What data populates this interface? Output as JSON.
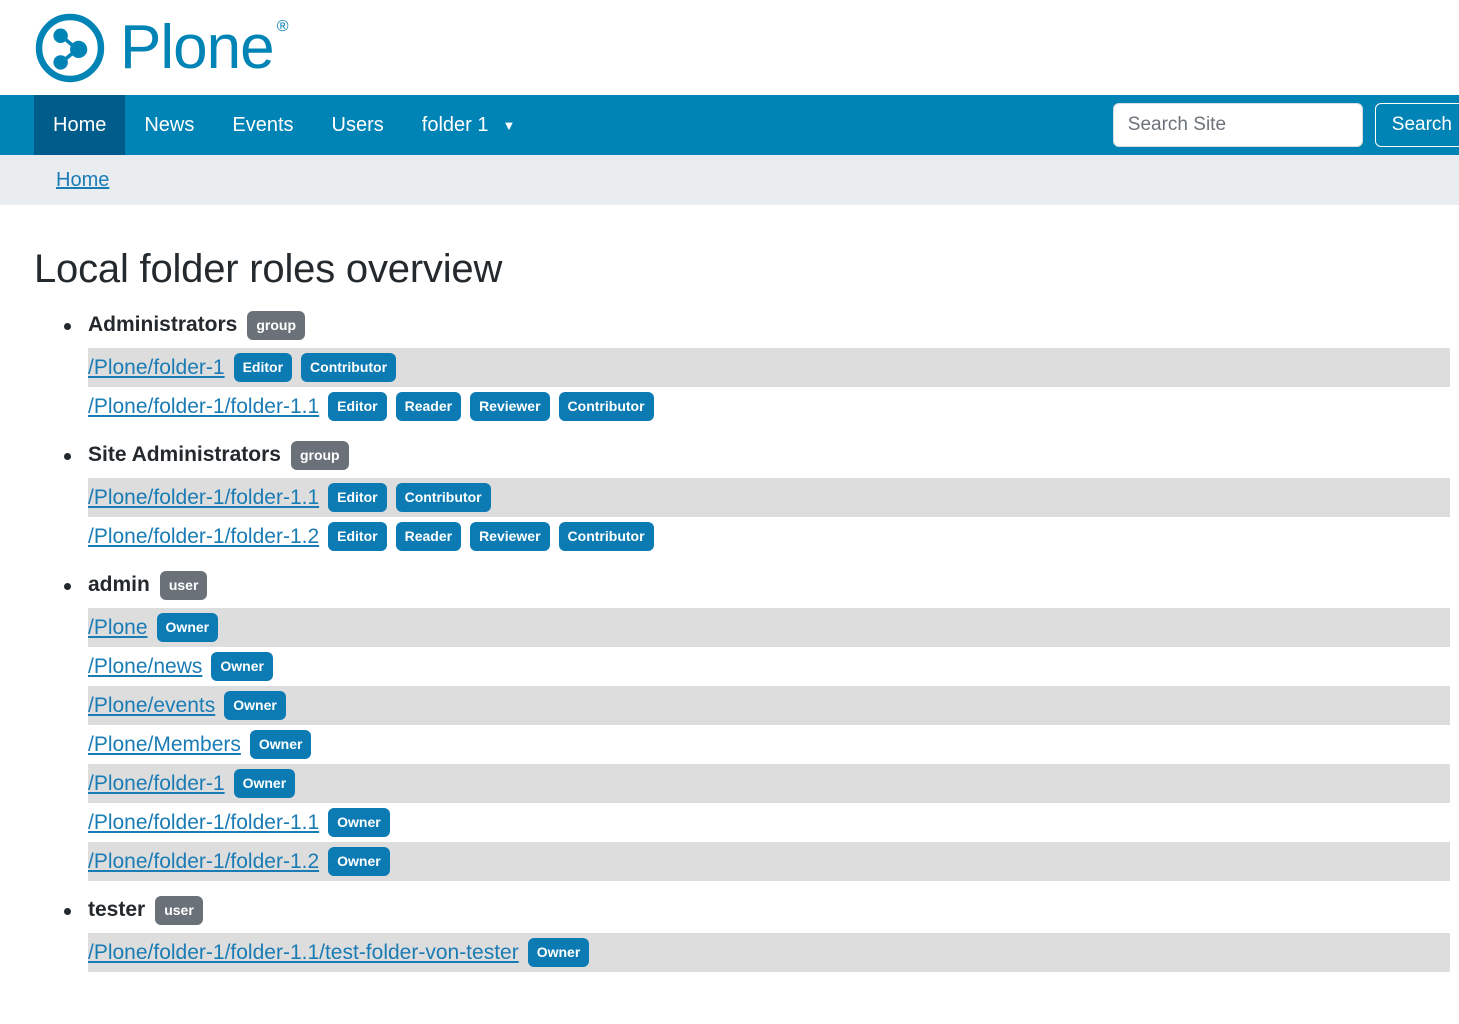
{
  "site": {
    "logo_text": "Plone",
    "logo_registered_mark": "®",
    "logo_icon": "plone-logo-icon"
  },
  "nav": {
    "items": [
      {
        "label": "Home",
        "active": true,
        "has_caret": false
      },
      {
        "label": "News",
        "active": false,
        "has_caret": false
      },
      {
        "label": "Events",
        "active": false,
        "has_caret": false
      },
      {
        "label": "Users",
        "active": false,
        "has_caret": false
      },
      {
        "label": "folder 1",
        "active": false,
        "has_caret": true
      }
    ],
    "caret_glyph": "▼"
  },
  "search": {
    "placeholder": "Search Site",
    "value": "",
    "button_label": "Search"
  },
  "breadcrumb": {
    "items": [
      {
        "label": "Home"
      }
    ]
  },
  "main": {
    "title": "Local folder roles overview",
    "principals": [
      {
        "name": "Administrators",
        "type": "group",
        "paths": [
          {
            "path": "/Plone/folder-1",
            "roles": [
              "Editor",
              "Contributor"
            ]
          },
          {
            "path": "/Plone/folder-1/folder-1.1",
            "roles": [
              "Editor",
              "Reader",
              "Reviewer",
              "Contributor"
            ]
          }
        ]
      },
      {
        "name": "Site Administrators",
        "type": "group",
        "paths": [
          {
            "path": "/Plone/folder-1/folder-1.1",
            "roles": [
              "Editor",
              "Contributor"
            ]
          },
          {
            "path": "/Plone/folder-1/folder-1.2",
            "roles": [
              "Editor",
              "Reader",
              "Reviewer",
              "Contributor"
            ]
          }
        ]
      },
      {
        "name": "admin",
        "type": "user",
        "paths": [
          {
            "path": "/Plone",
            "roles": [
              "Owner"
            ]
          },
          {
            "path": "/Plone/news",
            "roles": [
              "Owner"
            ]
          },
          {
            "path": "/Plone/events",
            "roles": [
              "Owner"
            ]
          },
          {
            "path": "/Plone/Members",
            "roles": [
              "Owner"
            ]
          },
          {
            "path": "/Plone/folder-1",
            "roles": [
              "Owner"
            ]
          },
          {
            "path": "/Plone/folder-1/folder-1.1",
            "roles": [
              "Owner"
            ]
          },
          {
            "path": "/Plone/folder-1/folder-1.2",
            "roles": [
              "Owner"
            ]
          }
        ]
      },
      {
        "name": "tester",
        "type": "user",
        "paths": [
          {
            "path": "/Plone/folder-1/folder-1.1/test-folder-von-tester",
            "roles": [
              "Owner"
            ]
          }
        ]
      }
    ]
  },
  "colors": {
    "brand_blue": "#0083b5",
    "nav_active": "#005d8b",
    "link_blue": "#1a7cb5",
    "role_badge": "#0c7bb3",
    "type_badge": "#6b7179",
    "row_stripe": "#dddddd",
    "breadcrumb_bg": "#e9edf0"
  }
}
